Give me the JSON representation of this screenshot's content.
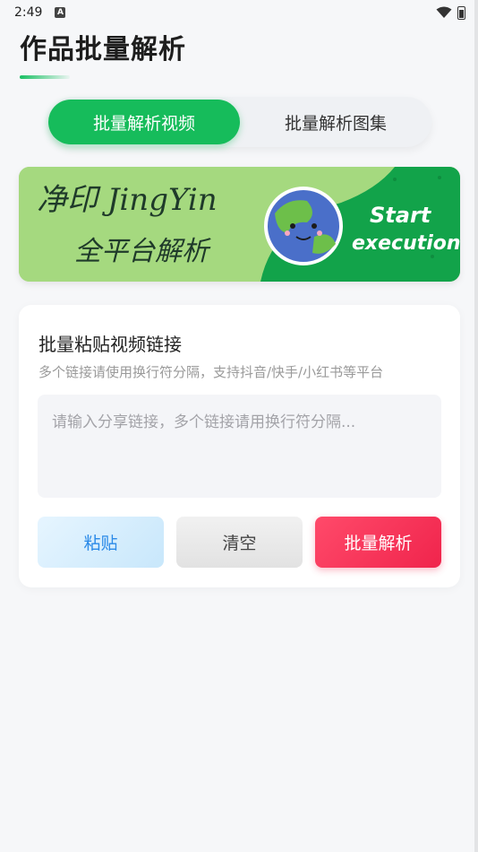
{
  "status_bar": {
    "time": "2:49",
    "indicator": "A"
  },
  "page": {
    "title": "作品批量解析"
  },
  "tabs": [
    {
      "label": "批量解析视频",
      "active": true
    },
    {
      "label": "批量解析图集",
      "active": false
    }
  ],
  "banner": {
    "line1": "净印 JingYin",
    "line2": "全平台解析",
    "cta_line1": "Start",
    "cta_line2": "execution",
    "colors": {
      "light": "#a5d97f",
      "dark": "#12a34a"
    }
  },
  "card": {
    "title": "批量粘贴视频链接",
    "subtitle": "多个链接请使用换行符分隔，支持抖音/快手/小红书等平台",
    "input": {
      "value": "",
      "placeholder": "请输入分享链接，多个链接请用换行符分隔..."
    },
    "buttons": {
      "paste": "粘贴",
      "clear": "清空",
      "parse": "批量解析"
    }
  },
  "colors": {
    "accent_green": "#16bc5b",
    "parse_red": "#f0244c",
    "paste_blue": "#2b8ae8"
  }
}
